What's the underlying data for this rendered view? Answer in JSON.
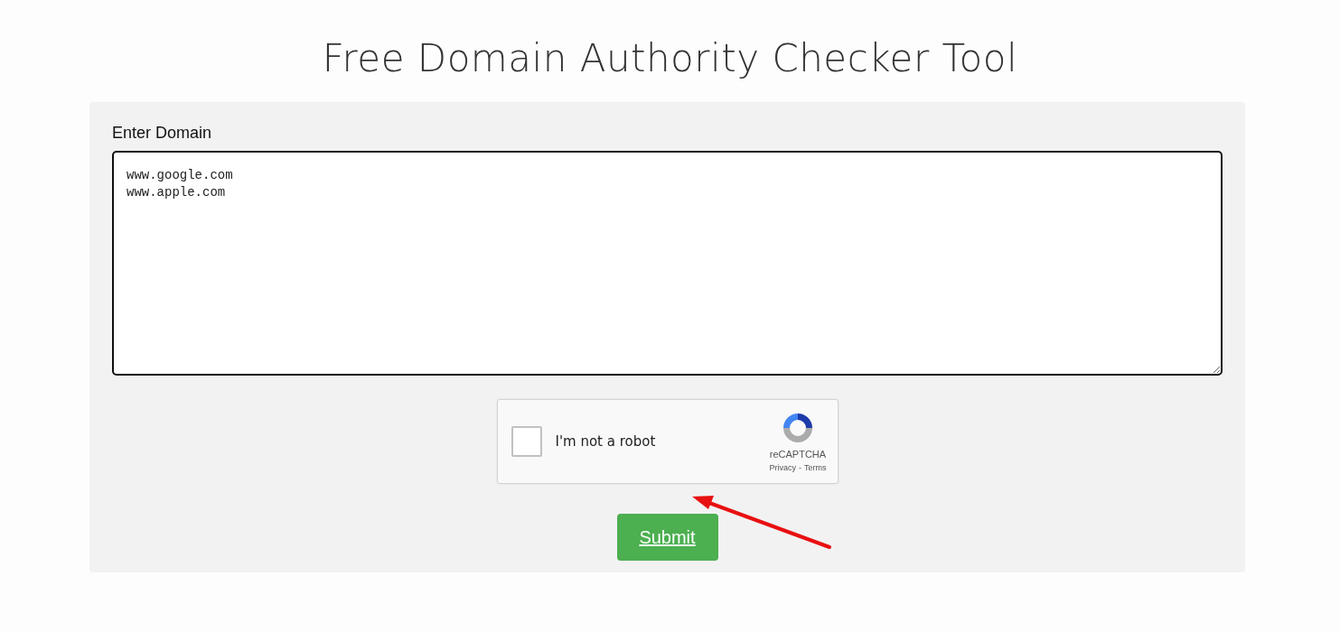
{
  "title": "Free Domain Authority Checker Tool",
  "domain_field": {
    "label": "Enter Domain",
    "value": "www.google.com\nwww.apple.com"
  },
  "captcha": {
    "label": "I'm not a robot",
    "checked": false,
    "brand": "reCAPTCHA",
    "links": [
      "Privacy",
      "Terms"
    ],
    "separator": "-"
  },
  "submit": {
    "label": "Submit"
  }
}
